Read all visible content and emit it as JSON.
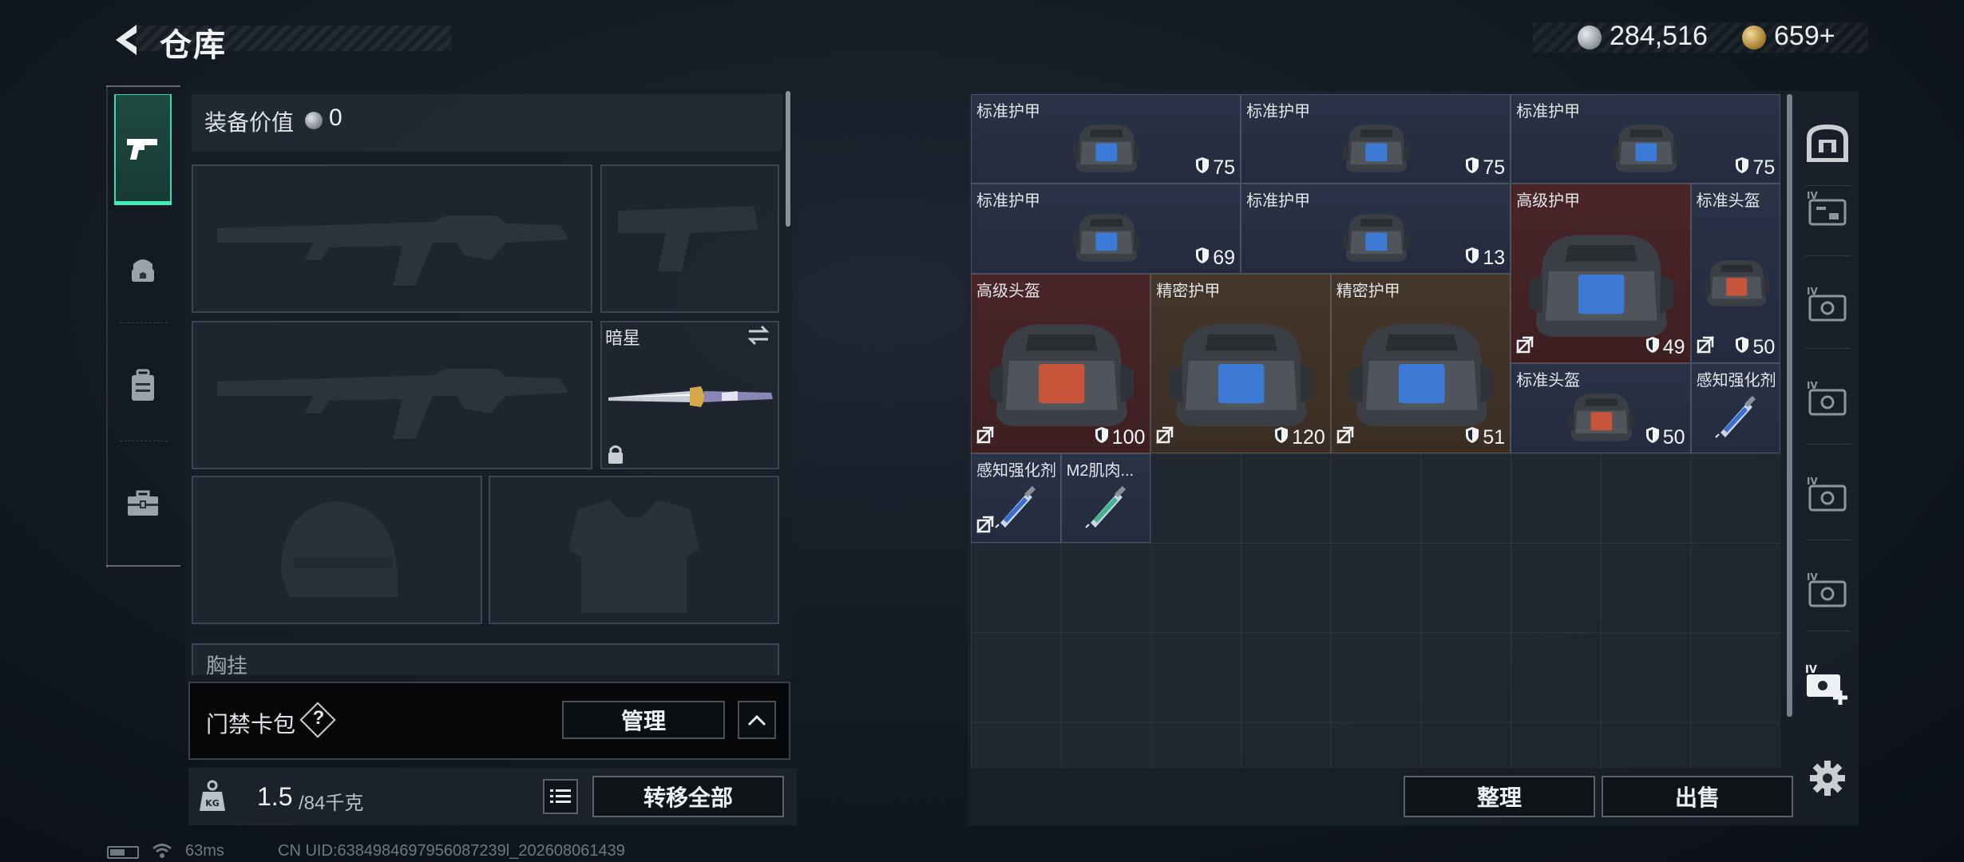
{
  "header": {
    "title": "仓库",
    "silver_value": "284,516",
    "gold_value": "659+"
  },
  "left_tabs": [
    "pistol-icon",
    "helmet-icon",
    "backpack-icon",
    "toolbox-icon"
  ],
  "equipment": {
    "value_label": "装备价值",
    "value": "0",
    "melee_name": "暗星",
    "chest_label": "胸挂",
    "card_bag_label": "门禁卡包",
    "card_bag_help": "?",
    "manage_label": "管理",
    "weight_current": "1.5",
    "weight_max": "/84千克",
    "transfer_all_label": "转移全部"
  },
  "storage": {
    "items": [
      {
        "name": "标准护甲",
        "durability": "75",
        "bg": "blue",
        "col": 0,
        "row": 0,
        "w": 3,
        "h": 1,
        "no_transfer": false
      },
      {
        "name": "标准护甲",
        "durability": "75",
        "bg": "blue",
        "col": 3,
        "row": 0,
        "w": 3,
        "h": 1,
        "no_transfer": false
      },
      {
        "name": "标准护甲",
        "durability": "75",
        "bg": "blue",
        "col": 6,
        "row": 0,
        "w": 3,
        "h": 1,
        "no_transfer": false
      },
      {
        "name": "标准护甲",
        "durability": "69",
        "bg": "blue",
        "col": 0,
        "row": 1,
        "w": 3,
        "h": 1,
        "no_transfer": false
      },
      {
        "name": "标准护甲",
        "durability": "13",
        "bg": "blue",
        "col": 3,
        "row": 1,
        "w": 3,
        "h": 1,
        "no_transfer": false
      },
      {
        "name": "高级护甲",
        "durability": "49",
        "bg": "red",
        "col": 6,
        "row": 1,
        "w": 2,
        "h": 2,
        "no_transfer": true
      },
      {
        "name": "标准头盔",
        "durability": "50",
        "bg": "blue",
        "col": 8,
        "row": 1,
        "w": 1,
        "h": 2,
        "no_transfer": true
      },
      {
        "name": "高级头盔",
        "durability": "100",
        "bg": "red",
        "col": 0,
        "row": 2,
        "w": 2,
        "h": 2,
        "no_transfer": true
      },
      {
        "name": "精密护甲",
        "durability": "120",
        "bg": "gold",
        "col": 2,
        "row": 2,
        "w": 2,
        "h": 2,
        "no_transfer": true
      },
      {
        "name": "精密护甲",
        "durability": "51",
        "bg": "gold",
        "col": 4,
        "row": 2,
        "w": 2,
        "h": 2,
        "no_transfer": true
      },
      {
        "name": "标准头盔",
        "durability": "50",
        "bg": "blue",
        "col": 6,
        "row": 3,
        "w": 2,
        "h": 1,
        "no_transfer": false
      },
      {
        "name": "感知强化剂",
        "durability": "",
        "bg": "blue",
        "col": 8,
        "row": 3,
        "w": 1,
        "h": 1,
        "no_transfer": false
      },
      {
        "name": "感知强化剂",
        "durability": "",
        "bg": "blue",
        "col": 0,
        "row": 4,
        "w": 1,
        "h": 1,
        "no_transfer": true
      },
      {
        "name": "M2肌肉...",
        "durability": "",
        "bg": "blue",
        "col": 1,
        "row": 4,
        "w": 1,
        "h": 1,
        "no_transfer": false
      }
    ],
    "sort_label": "整理",
    "sell_label": "出售"
  },
  "right_sidebar": [
    "safe-icon",
    "card-slot-iv-1",
    "card-slot-iv-2",
    "card-slot-iv-3",
    "card-slot-iv-4",
    "card-slot-iv-5",
    "add-card-icon",
    "settings-icon"
  ],
  "status": {
    "ping": "63ms",
    "uid": "CN UID:6384984697956087239l_202608061439"
  },
  "colors": {
    "accent": "#3ff0b4",
    "item_blue": "#2a3247",
    "item_red": "#4a2528",
    "item_gold": "#45362a"
  }
}
